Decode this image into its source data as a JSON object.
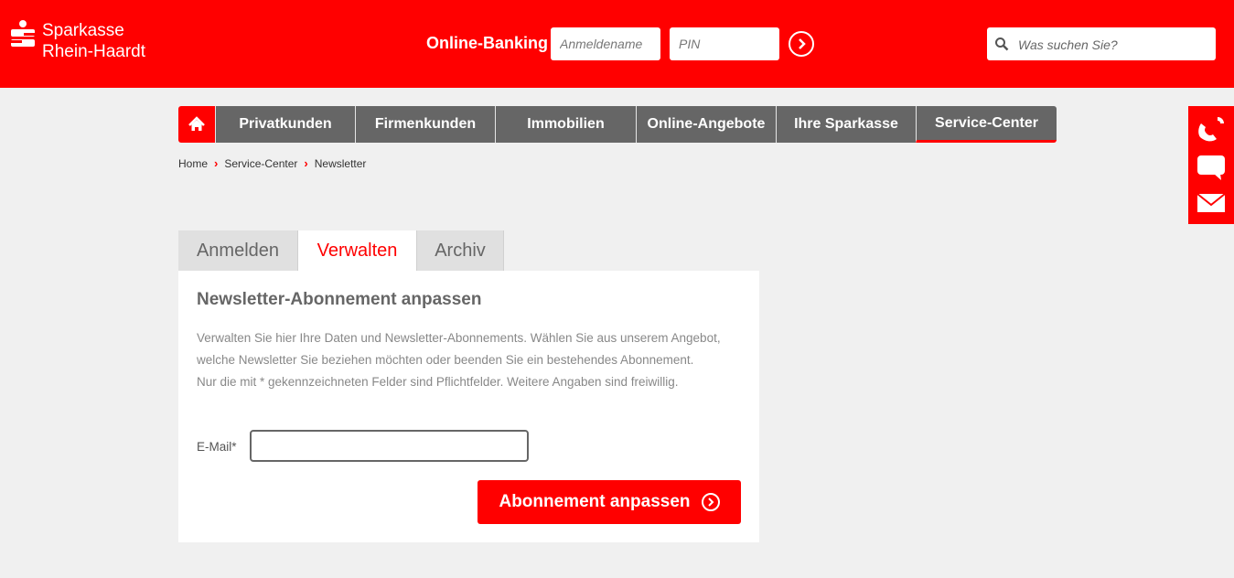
{
  "header": {
    "brand_line1": "Sparkasse",
    "brand_line2": "Rhein-Haardt",
    "online_banking_label": "Online-Banking",
    "username_placeholder": "Anmeldename",
    "pin_placeholder": "PIN",
    "search_placeholder": "Was suchen Sie?"
  },
  "nav": {
    "items": [
      {
        "label": "Privatkunden"
      },
      {
        "label": "Firmenkunden"
      },
      {
        "label": "Immobilien"
      },
      {
        "label": "Online-Angebote"
      },
      {
        "label": "Ihre Sparkasse"
      },
      {
        "label": "Service-Center",
        "active": true
      }
    ]
  },
  "breadcrumb": [
    "Home",
    "Service-Center",
    "Newsletter"
  ],
  "tabs": [
    {
      "label": "Anmelden"
    },
    {
      "label": "Verwalten",
      "active": true
    },
    {
      "label": "Archiv"
    }
  ],
  "panel": {
    "title": "Newsletter-Abonnement anpassen",
    "text_line1": "Verwalten Sie hier Ihre Daten und Newsletter-Abonnements. Wählen Sie aus unserem Angebot,",
    "text_line2": "welche Newsletter Sie beziehen möchten oder beenden Sie ein bestehendes Abonnement.",
    "text_line3": "Nur die mit * gekennzeichneten Felder sind Pflichtfelder. Weitere Angaben sind freiwillig.",
    "email_label": "E-Mail*",
    "email_value": "",
    "submit_label": "Abonnement anpassen"
  },
  "colors": {
    "brand_red": "#ff0000",
    "nav_gray": "#666666",
    "page_bg": "#f0f0f0"
  },
  "icons": [
    "sparkasse-logo-icon",
    "arrow-right-circle-icon",
    "search-icon",
    "home-icon",
    "chevron-right-icon",
    "phone-icon",
    "chat-icon",
    "mail-icon"
  ]
}
